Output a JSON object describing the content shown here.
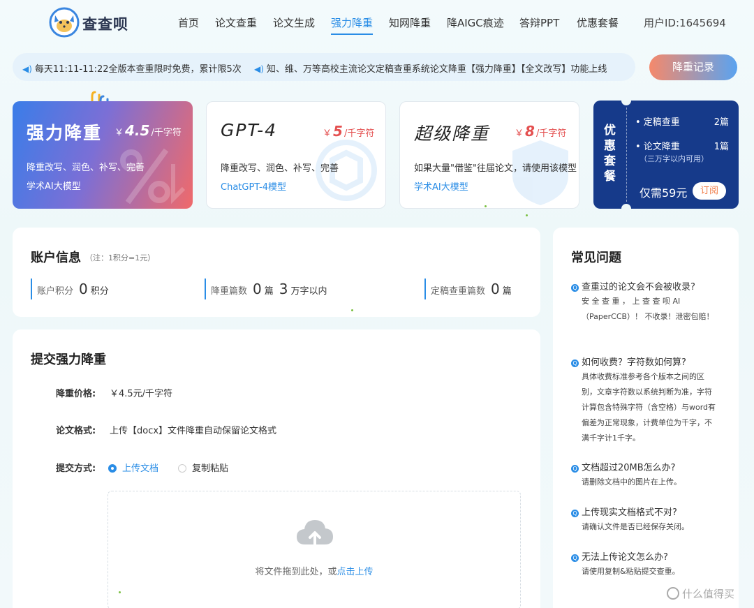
{
  "header": {
    "logo_text": "查查呗",
    "nav": [
      "首页",
      "论文查重",
      "论文生成",
      "强力降重",
      "知网降重",
      "降AIGC痕迹",
      "答辩PPT",
      "优惠套餐"
    ],
    "active_nav": "强力降重",
    "user_id": "用户ID:1645694"
  },
  "notice": {
    "items": [
      "每天11:11-11:22全版本查重限时免费，累计限5次",
      "知、维、万等高校主流论文定稿查重系统论文降重【强力降重】【全文改写】功能上线"
    ],
    "record_button": "降重记录"
  },
  "products": [
    {
      "name": "强力降重",
      "currency": "￥",
      "price": "4.5",
      "unit": "/千字符",
      "desc": "降重改写、润色、补写、完善",
      "model": "学术AI大模型"
    },
    {
      "name": "GPT-4",
      "currency": "￥",
      "price": "5",
      "unit": "/千字符",
      "desc": "降重改写、润色、补写、完善",
      "model": "ChatGPT-4模型"
    },
    {
      "name": "超级降重",
      "currency": "￥",
      "price": "8",
      "unit": "/千字符",
      "desc": "如果大量\"借鉴\"往届论文，请使用该模型",
      "model": "学术AI大模型"
    }
  ],
  "package": {
    "title": "优惠套餐",
    "line1_label": "• 定稿查重",
    "line1_count": "2篇",
    "line2_label": "• 论文降重",
    "line2_count": "1篇",
    "line2_note": "（三万字以内可用）",
    "price": "仅需59元",
    "button": "订阅"
  },
  "account": {
    "title": "账户信息",
    "note": "（注：1积分=1元）",
    "stats": [
      {
        "label": "账户积分",
        "value": "0",
        "unit": "积分",
        "value2": "",
        "unit2": ""
      },
      {
        "label": "降重篇数",
        "value": "0",
        "unit": "篇",
        "value2": "3",
        "unit2": "万字以内"
      },
      {
        "label": "定稿查重篇数",
        "value": "0",
        "unit": "篇",
        "value2": "",
        "unit2": ""
      }
    ]
  },
  "submit": {
    "title": "提交强力降重",
    "price_label": "降重价格:",
    "price_value": "￥4.5元/千字符",
    "format_label": "论文格式:",
    "format_value": "上传【docx】文件降重自动保留论文格式",
    "method_label": "提交方式:",
    "method_options": [
      "上传文档",
      "复制粘贴"
    ],
    "method_selected": "上传文档",
    "upload_text": "将文件拖到此处，或",
    "upload_link": "点击上传"
  },
  "faq": {
    "title": "常见问题",
    "items": [
      {
        "q": "查重过的论文会不会被收录?",
        "a": "安 全 查 重 ， 上 查 查 呗 AI （PaperCCB）！ 不收录！泄密包赔！"
      },
      {
        "q": "如何收费？字符数如何算?",
        "a": "具体收费标准参考各个版本之间的区别，文章字符数以系统判断为准，字符计算包含特殊字符（含空格）与word有偏差为正常现象，计费单位为千字，不满千字计1千字。"
      },
      {
        "q": "文档超过20MB怎么办?",
        "a": "请删除文档中的图片在上传。"
      },
      {
        "q": "上传现实文档格式不对?",
        "a": "请确认文件是否已经保存关闭。"
      },
      {
        "q": "无法上传论文怎么办?",
        "a": "请使用复制&粘贴提交查重。"
      }
    ]
  },
  "watermark": "什么值得买",
  "colors": {
    "accent": "#2a8de6",
    "price_red": "#e45050",
    "package_bg": "#163a8a"
  }
}
